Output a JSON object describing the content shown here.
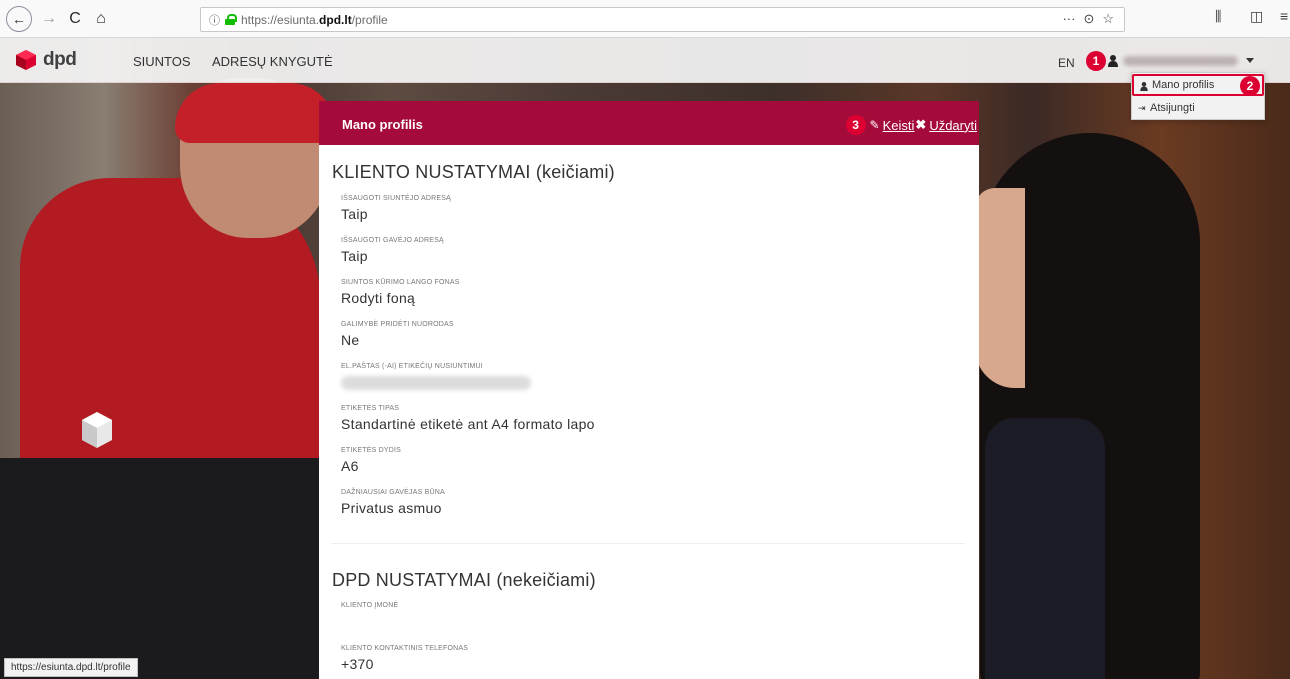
{
  "browser": {
    "url_prefix": "https://esiunta.",
    "url_domain": "dpd.lt",
    "url_suffix": "/profile",
    "back_glyph": "←",
    "forward_glyph": "→",
    "reload_glyph": "C",
    "home_glyph": "⌂",
    "more_glyph": "···",
    "pocket_glyph": "⊙",
    "bookmark_glyph": "☆",
    "library_glyph": "⫼",
    "sidebar_glyph": "◫",
    "menu_glyph": "≡",
    "status_url": "https://esiunta.dpd.lt/profile"
  },
  "header": {
    "logo_text": "dpd",
    "nav": [
      "SIUNTOS",
      "ADRESŲ KNYGUTĖ"
    ],
    "lang": "EN",
    "caret": "▾"
  },
  "dropdown": {
    "items": [
      "Mano profilis",
      "Atsijungti"
    ]
  },
  "steps": [
    "1",
    "2",
    "3"
  ],
  "modal": {
    "title": "Mano profilis",
    "edit_label": "Keisti",
    "close_label": "Uždaryti",
    "section1_title": "KLIENTO NUSTATYMAI (keičiami)",
    "section1_fields": [
      {
        "label": "IŠSAUGOTI SIUNTĖJO ADRESĄ",
        "value": "Taip"
      },
      {
        "label": "IŠSAUGOTI GAVĖJO ADRESĄ",
        "value": "Taip"
      },
      {
        "label": "SIUNTOS KŪRIMO LANGO FONAS",
        "value": "Rodyti foną"
      },
      {
        "label": "GALIMYBĖ PRIDĖTI NUORODAS",
        "value": "Ne"
      },
      {
        "label": "EL.PAŠTAS (-AI) ETIKEČIŲ NUSIUNTIMUI",
        "value": ""
      },
      {
        "label": "ETIKETĖS TIPAS",
        "value": "Standartinė etiketė ant A4 formato lapo"
      },
      {
        "label": "ETIKETĖS DYDIS",
        "value": "A6"
      },
      {
        "label": "DAŽNIAUSIAI GAVĖJAS BŪNA",
        "value": "Privatus asmuo"
      }
    ],
    "section2_title": "DPD NUSTATYMAI (nekeičiami)",
    "section2_fields": [
      {
        "label": "KLIENTO ĮMONĖ",
        "value": ""
      },
      {
        "label": "KLIENTO KONTAKTINIS TELEFONAS",
        "value": "+370"
      }
    ]
  },
  "colors": {
    "brand_red": "#dc0032",
    "modal_header": "#a50b3a"
  }
}
